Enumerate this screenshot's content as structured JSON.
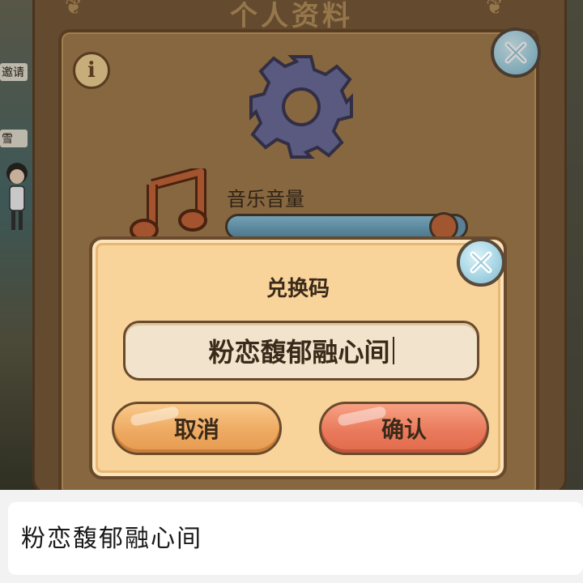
{
  "background": {
    "side_texts": [
      "邀请",
      "雪"
    ]
  },
  "profile": {
    "title": "个人资料",
    "info_icon": "info-icon",
    "close_icon": "close-icon",
    "settings_icon": "gear-icon",
    "music_icon": "music-note-icon",
    "volume": {
      "label": "音乐音量",
      "level": 0.9
    }
  },
  "redeem_dialog": {
    "title": "兑换码",
    "input_value": "粉恋馥郁融心间",
    "cancel_label": "取消",
    "confirm_label": "确认",
    "close_icon": "close-icon"
  },
  "ime": {
    "candidate": "粉恋馥郁融心间"
  },
  "colors": {
    "panel": "#a57e4d",
    "dialog": "#f8d39a",
    "cancel": "#eeaa62",
    "confirm": "#ea7a5c",
    "close": "#a8d6e5"
  }
}
